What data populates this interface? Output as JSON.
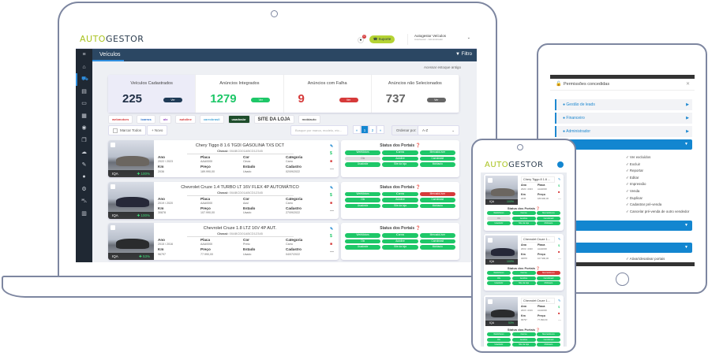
{
  "brand": {
    "part1": "AUTO",
    "part2": "GESTOR"
  },
  "colors": {
    "green": "#1ec768",
    "red": "#d63a3a",
    "navy": "#1f3b57",
    "grey": "#666666",
    "lime": "#b5d334",
    "nav": "#2b4763",
    "sidebar": "#1f2833",
    "accent": "#1386d0"
  },
  "laptop": {
    "topbar": {
      "notification_count": "0",
      "support_label": "Suporte",
      "user_name": "Autogestor Veículos",
      "user_role": "AutoGestor - Administrador"
    },
    "page_title": "Veículos",
    "filter_label": "Filtro",
    "sidebar_icons": [
      "menu-icon",
      "home-icon",
      "car-icon",
      "file-icon",
      "money-icon",
      "clipboard-icon",
      "eye-icon",
      "copy-icon",
      "cloud-upload-icon",
      "edit-icon",
      "globe-icon",
      "gear-icon",
      "cart-icon",
      "chart-icon"
    ],
    "legacy_link": "Acessar estoque antigo",
    "stats": [
      {
        "label": "Veículos Cadastrados",
        "value": "225",
        "button": "Ver",
        "color": "#1f3b57"
      },
      {
        "label": "Anúncios Integrados",
        "value": "1279",
        "button": "Ver",
        "color": "#1ec768"
      },
      {
        "label": "Anúncios com Falha",
        "value": "9",
        "button": "Ver",
        "color": "#d63a3a"
      },
      {
        "label": "Anúncios não Selecionados",
        "value": "737",
        "button": "Ver",
        "color": "#666666"
      }
    ],
    "portal_logos": [
      "webmotors",
      "icarros",
      "olx",
      "autoline",
      "carrobrasil",
      "usadosbr",
      "SITE DA LOJA",
      "mobiauto"
    ],
    "toolbar": {
      "select_all": "Marcar Todos",
      "new_button": "+ Novo",
      "search_placeholder": "Busque por marca, modelo, etc...",
      "pages": [
        "«",
        "1",
        "2",
        "»"
      ],
      "current_page": "1",
      "sort_label": "Ordenar por:",
      "sort_value": "A-Z"
    },
    "field_labels": {
      "year": "Ano",
      "plate": "Placa",
      "color": "Cor",
      "category": "Categoria",
      "km": "Km",
      "price": "Preço",
      "state": "Estado",
      "registered": "Cadastro",
      "chassis": "Chassi:",
      "iqa": "IQA"
    },
    "status_title": "Status dos Portais",
    "vehicles": [
      {
        "title": "Chery Tiggo 8 1.6 TGDI GASOLINA TXS DCT",
        "chassis": "00ABCD01ABCD12345",
        "year": "2022 / 2023",
        "plate": "AAA0000",
        "color": "Cinza",
        "category": "Carro",
        "km": "2036",
        "price": "189.990,00",
        "state": "Usado",
        "registered": "02/09/2022",
        "iqa": "100%",
        "car_color": "#6b6660",
        "portals": [
          {
            "name": "WebMotors",
            "status": "ok"
          },
          {
            "name": "iCarros",
            "status": "ok"
          },
          {
            "name": "MercadoLivre",
            "status": "ok"
          },
          {
            "name": "Olx",
            "status": "off"
          },
          {
            "name": "Autoline",
            "status": "ok"
          },
          {
            "name": "Carrobrasil",
            "status": "ok"
          },
          {
            "name": "Usadosbr",
            "status": "ok"
          },
          {
            "name": "Site da loja",
            "status": "ok"
          },
          {
            "name": "Mobiauto",
            "status": "ok"
          }
        ]
      },
      {
        "title": "Chevrolet Cruze 1.4 TURBO LT 16V FLEX 4P AUTOMÁTICO",
        "chassis": "00ABCD01ABCD12345",
        "year": "2019 / 2020",
        "plate": "AAA0000",
        "color": "Azul",
        "category": "Carro",
        "km": "30878",
        "price": "107.990,00",
        "state": "Usado",
        "registered": "27/09/2022",
        "iqa": "100%",
        "car_color": "#262838",
        "portals": [
          {
            "name": "WebMotors",
            "status": "ok"
          },
          {
            "name": "iCarros",
            "status": "ok"
          },
          {
            "name": "MercadoLivre",
            "status": "fail"
          },
          {
            "name": "Olx",
            "status": "ok"
          },
          {
            "name": "Autoline",
            "status": "ok"
          },
          {
            "name": "Carrobrasil",
            "status": "ok"
          },
          {
            "name": "Usadosbr",
            "status": "ok"
          },
          {
            "name": "Site da loja",
            "status": "ok"
          },
          {
            "name": "Mobiauto",
            "status": "ok"
          }
        ]
      },
      {
        "title": "Chevrolet Cruze 1.8 LTZ 16V 4P AUT.",
        "chassis": "00ABCD01ABCD12345",
        "year": "2015 / 2016",
        "plate": "AAA0000",
        "color": "Preto",
        "category": "Carro",
        "km": "96797",
        "price": "77.990,00",
        "state": "Usado",
        "registered": "04/07/2022",
        "iqa": "53%",
        "car_color": "#2a2b2d",
        "portals": [
          {
            "name": "WebMotors",
            "status": "ok"
          },
          {
            "name": "iCarros",
            "status": "ok"
          },
          {
            "name": "MercadoLivre",
            "status": "ok"
          },
          {
            "name": "Olx",
            "status": "ok"
          },
          {
            "name": "Autoline",
            "status": "ok"
          },
          {
            "name": "Carrobrasil",
            "status": "ok"
          },
          {
            "name": "Usadosbr",
            "status": "ok"
          },
          {
            "name": "Site da loja",
            "status": "ok"
          },
          {
            "name": "Mobiauto",
            "status": "ok"
          }
        ]
      }
    ]
  },
  "tablet": {
    "modal_title": "Permissões concedidas",
    "sections": [
      "Gestão de leads",
      "Financeiro",
      "Administrador"
    ],
    "permissions_right": [
      "Ver excluídos",
      "Excluir",
      "Reportar",
      "Editar",
      "Impressão",
      "Venda",
      "Duplicar",
      "Cadastrar pré-venda",
      "Cancelar pré-venda de outro vendedor"
    ],
    "last_permission": "Ativar/desativar portais"
  },
  "phone": {
    "vehicles": [
      {
        "title": "Chery Tiggo 8 1.6 ...",
        "year": "2022 / 2023",
        "plate": "AAA0000",
        "km": "2036",
        "price": "189.990,00",
        "iqa": "100%"
      },
      {
        "title": "Chevrolet Cruze 1...",
        "year": "2019 / 2020",
        "plate": "AAA0000",
        "km": "30878",
        "price": "107.990,00",
        "iqa": "100%"
      },
      {
        "title": "Chevrolet Cruze 1...",
        "year": "2015 / 2016",
        "plate": "AAA0000",
        "km": "96797",
        "price": "77.990,00",
        "iqa": "53%"
      }
    ]
  }
}
